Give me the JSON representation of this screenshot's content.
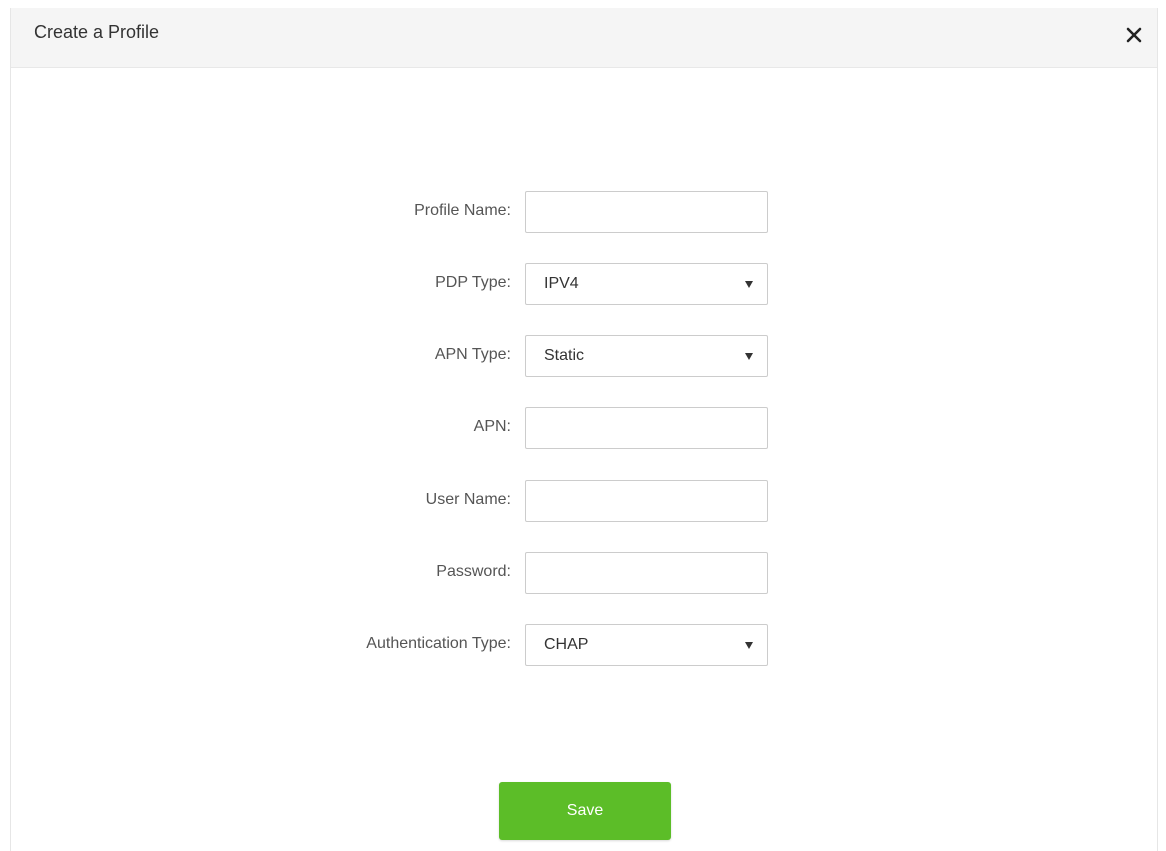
{
  "dialog": {
    "title": "Create a Profile"
  },
  "icons": {
    "close": "close-icon",
    "dropdown": "caret-down-icon"
  },
  "form": {
    "profile_name": {
      "label": "Profile Name:",
      "value": "",
      "placeholder": ""
    },
    "pdp_type": {
      "label": "PDP Type:",
      "value": "IPV4"
    },
    "apn_type": {
      "label": "APN Type:",
      "value": "Static"
    },
    "apn": {
      "label": "APN:",
      "value": "",
      "placeholder": ""
    },
    "user_name": {
      "label": "User Name:",
      "value": "",
      "placeholder": ""
    },
    "password": {
      "label": "Password:",
      "value": "",
      "placeholder": ""
    },
    "auth_type": {
      "label": "Authentication Type:",
      "value": "CHAP"
    }
  },
  "actions": {
    "save_label": "Save"
  },
  "colors": {
    "save_button": "#5cbd28",
    "header_bg": "#f5f5f5"
  }
}
